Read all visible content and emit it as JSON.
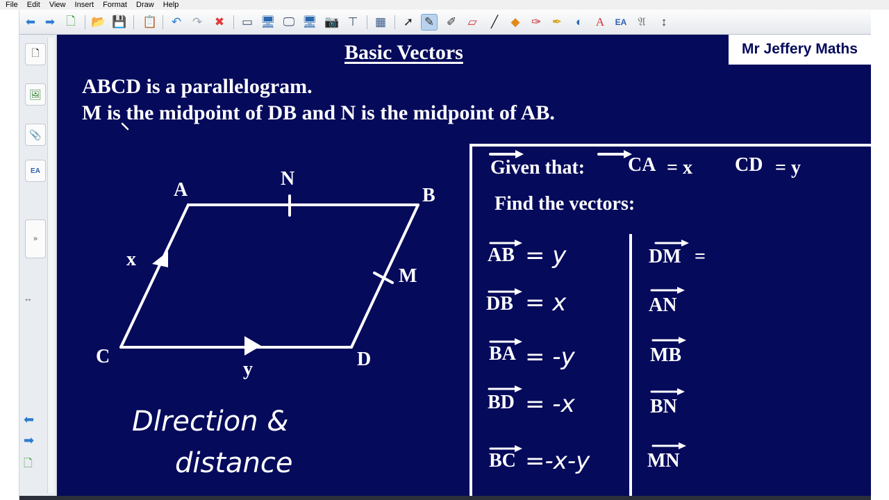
{
  "menu": [
    "File",
    "Edit",
    "View",
    "Insert",
    "Format",
    "Draw",
    "Help"
  ],
  "toolbar_icons": [
    "back-icon",
    "forward-icon",
    "new-page-icon",
    "open-icon",
    "save-icon",
    "paste-icon",
    "undo-icon",
    "redo-icon",
    "delete-icon",
    "screen-shade-icon",
    "show-display-icon",
    "capture-icon",
    "monitor-icon",
    "camera-icon",
    "document-camera-icon",
    "table-icon",
    "select-icon",
    "pen-icon",
    "creative-pen-icon",
    "eraser-icon",
    "line-icon",
    "shapes-icon",
    "magic-pen-icon",
    "highlighter-icon",
    "fill-icon",
    "text-icon",
    "properties-icon",
    "font-icon",
    "move-toolbar-icon"
  ],
  "page": {
    "title": "Basic Vectors",
    "brand": "Mr Jeffery Maths",
    "line1": "ABCD is a parallelogram.",
    "line2": "M is the midpoint of DB and N is the midpoint of AB."
  },
  "figure": {
    "labels": {
      "A": "A",
      "B": "B",
      "C": "C",
      "D": "D",
      "N": "N",
      "M": "M"
    },
    "side_labels": {
      "x": "x",
      "y": "y"
    },
    "handwriting": [
      "Dlrection &",
      "distance"
    ]
  },
  "panel": {
    "given_label": "Given that:",
    "given": [
      {
        "vector": "CA",
        "value": "= x"
      },
      {
        "vector": "CD",
        "value": "= y"
      }
    ],
    "find": "Find the vectors:",
    "left_column": [
      {
        "vector": "AB",
        "answer": "= y"
      },
      {
        "vector": "DB",
        "answer": "= x"
      },
      {
        "vector": "BA",
        "answer": "= -y"
      },
      {
        "vector": "BD",
        "answer": "= -x"
      },
      {
        "vector": "BC",
        "answer": "=-x-y"
      }
    ],
    "right_column": [
      {
        "vector": "DM",
        "answer": "="
      },
      {
        "vector": "AN",
        "answer": ""
      },
      {
        "vector": "MB",
        "answer": ""
      },
      {
        "vector": "BN",
        "answer": ""
      },
      {
        "vector": "MN",
        "answer": ""
      }
    ]
  }
}
